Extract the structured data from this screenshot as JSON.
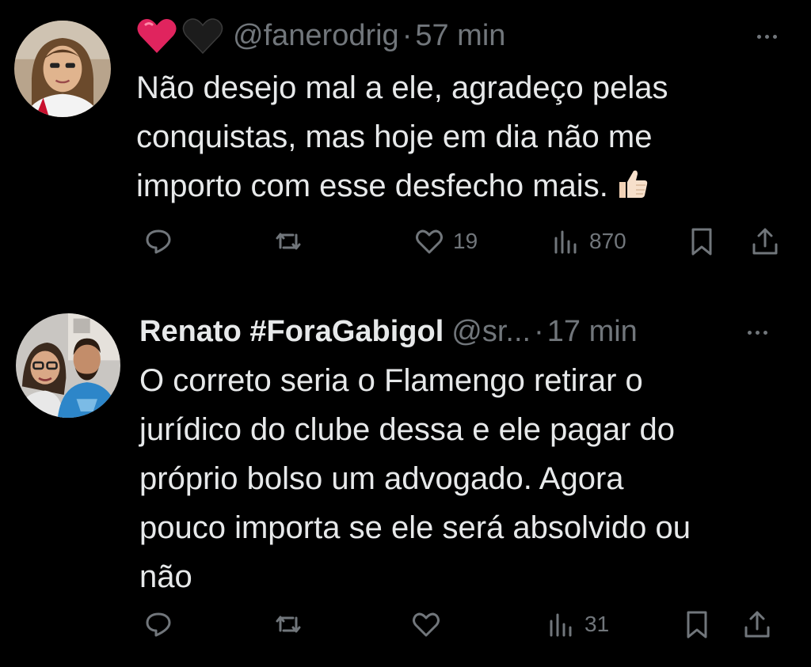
{
  "tweets": [
    {
      "display_name": "",
      "handle": "@fanerodrig",
      "separator": "·",
      "time": "57 min",
      "emoji_prefix": [
        "red-heart",
        "black-heart"
      ],
      "text_lines": [
        "Não desejo mal a ele, agradeço pelas",
        "conquistas, mas hoje em dia não me",
        "importo com esse desfecho mais."
      ],
      "trailing_emoji": "thumbs-up",
      "actions": {
        "reply_count": "",
        "retweet_count": "",
        "like_count": "19",
        "view_count": "870"
      }
    },
    {
      "display_name": "Renato #ForaGabigol",
      "handle": "@sr...",
      "separator": "·",
      "time": "17 min",
      "text_lines": [
        "O correto seria o Flamengo retirar o",
        "jurídico do clube dessa e ele pagar do",
        "próprio bolso um advogado. Agora",
        "pouco importa se ele será absolvido ou",
        "não"
      ],
      "actions": {
        "reply_count": "",
        "retweet_count": "",
        "like_count": "",
        "view_count": "31"
      }
    }
  ],
  "colors": {
    "background": "#000000",
    "text": "#e7e9ea",
    "muted": "#71767b",
    "heart_red": "#e0245e"
  },
  "icons": [
    "reply-icon",
    "retweet-icon",
    "like-icon",
    "views-icon",
    "bookmark-icon",
    "share-icon",
    "more-icon"
  ]
}
